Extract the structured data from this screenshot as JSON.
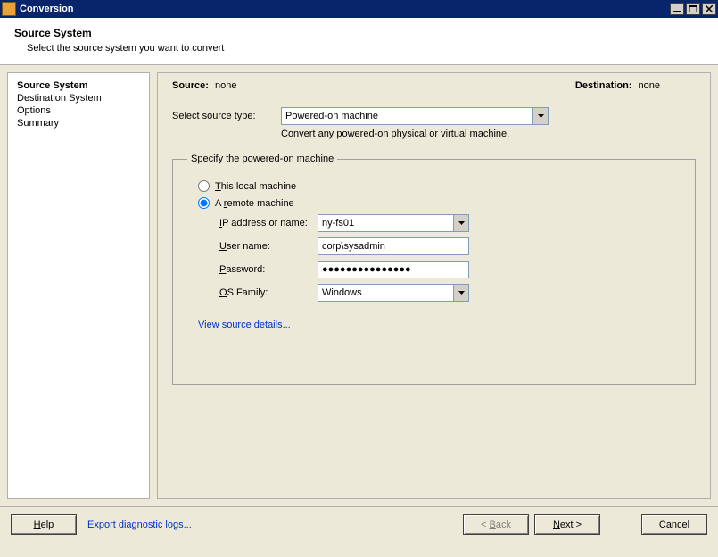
{
  "window": {
    "title": "Conversion"
  },
  "header": {
    "title": "Source System",
    "subtitle": "Select the source system you want to convert"
  },
  "sidebar": {
    "items": [
      {
        "label": "Source System",
        "active": true
      },
      {
        "label": "Destination System",
        "active": false
      },
      {
        "label": "Options",
        "active": false
      },
      {
        "label": "Summary",
        "active": false
      }
    ]
  },
  "top": {
    "source_label": "Source:",
    "source_value": "none",
    "destination_label": "Destination:",
    "destination_value": "none"
  },
  "source_type": {
    "label": "Select source type:",
    "value": "Powered-on machine",
    "hint": "Convert any powered-on physical or virtual machine."
  },
  "fieldset": {
    "legend": "Specify the powered-on machine",
    "radio_local": "This local machine",
    "radio_remote": "A remote machine",
    "radio_selected": "remote",
    "ip_label_pre": "I",
    "ip_label_rest": "P address or name:",
    "ip_value": "ny-fs01",
    "user_label_pre": "U",
    "user_label_rest": "ser name:",
    "user_value": "corp\\sysadmin",
    "pass_label_pre": "P",
    "pass_label_rest": "assword:",
    "pass_value": "●●●●●●●●●●●●●●●",
    "os_label_pre": "O",
    "os_label_rest": "S Family:",
    "os_value": "Windows",
    "view_link": "View source details..."
  },
  "footer": {
    "help": "Help",
    "export": "Export diagnostic logs...",
    "back": "< Back",
    "next": "Next >",
    "cancel": "Cancel"
  }
}
